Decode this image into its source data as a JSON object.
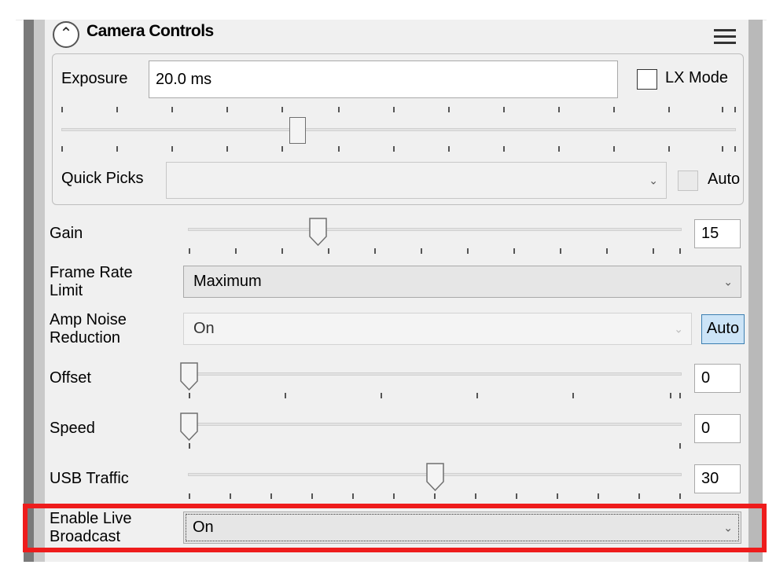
{
  "panel": {
    "title": "Camera Controls",
    "collapse_icon": "chevron-up-icon",
    "menu_icon": "hamburger-menu-icon"
  },
  "exposure": {
    "label": "Exposure",
    "value": "20.0 ms",
    "lx_mode_label": "LX Mode",
    "lx_mode_checked": false,
    "slider_level": 0.35
  },
  "quick_picks": {
    "label": "Quick Picks",
    "value": "",
    "auto_label": "Auto",
    "auto_checked": false
  },
  "gain": {
    "label": "Gain",
    "value": "15",
    "slider_level": 0.26
  },
  "frame_rate": {
    "label_line1": "Frame Rate",
    "label_line2": "Limit",
    "value": "Maximum"
  },
  "amp_noise": {
    "label_line1": "Amp Noise",
    "label_line2": "Reduction",
    "value": "On",
    "auto_button": "Auto"
  },
  "offset": {
    "label": "Offset",
    "value": "0",
    "slider_level": 0.0
  },
  "speed": {
    "label": "Speed",
    "value": "0",
    "slider_level": 0.0
  },
  "usb_traffic": {
    "label": "USB Traffic",
    "value": "30",
    "slider_level": 0.5
  },
  "live_broadcast": {
    "label_line1": "Enable Live",
    "label_line2": "Broadcast",
    "value": "On"
  },
  "colors": {
    "highlight": "#ee1c1c",
    "auto_button_bg": "#cce4f7"
  }
}
